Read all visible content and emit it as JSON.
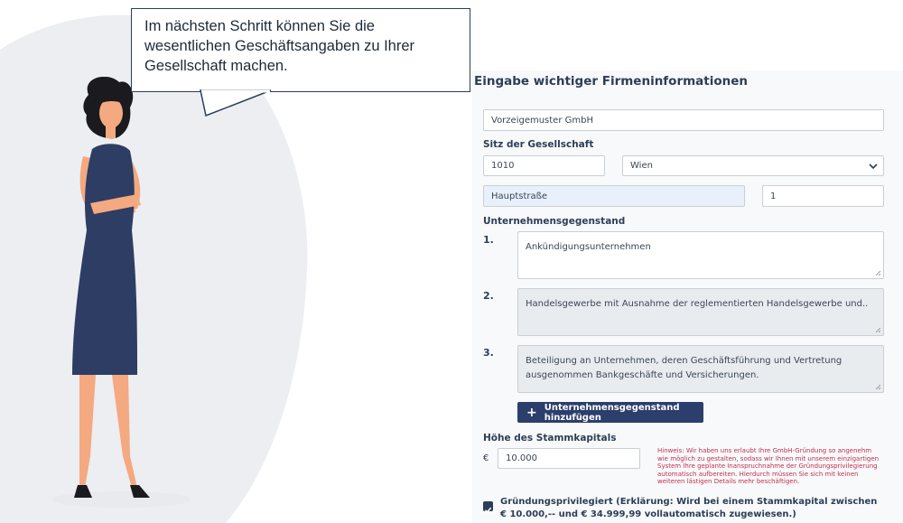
{
  "bubble": {
    "text": "Im nächsten Schritt können Sie die wesentlichen Geschäftsangaben zu Ihrer Gesellschaft machen."
  },
  "panel": {
    "title": "Eingabe wichtiger Firmeninformationen",
    "company_name": "Vorzeigemuster GmbH",
    "seat_label": "Sitz der Gesellschaft",
    "zip": "1010",
    "city": "Wien",
    "street": "Hauptstraße",
    "house_number": "1",
    "purpose_label": "Unternehmensgegenstand",
    "purposes": [
      {
        "num": "1.",
        "text": "Ankündigungsunternehmen"
      },
      {
        "num": "2.",
        "text": "Handelsgewerbe mit Ausnahme der reglementierten Handelsgewerbe und.."
      },
      {
        "num": "3.",
        "text": "Beteiligung an Unternehmen, deren Geschäftsführung und Vertretung ausgenommen Bankgeschäfte und Versicherungen."
      }
    ],
    "add_purpose_button": "Unternehmensgegenstand hinzufügen",
    "capital_label": "Höhe des Stammkapitals",
    "currency": "€",
    "capital_value": "10.000",
    "hint": "Hinweis: Wir haben uns erlaubt Ihre GmbH-Gründung so angenehm wie möglich zu gestalten, sodass wir Ihnen mit unserem einzigartigen System Ihre geplante Inanspruchnahme der Gründungsprivilegierung automatisch aufbereiten. Hierdurch müssen Sie sich mit keinen weiteren lästigen Details mehr beschäftigen.",
    "privilege_checkbox": "Gründungsprivilegiert (Erklärung: Wird bei einem Stammkapital zwischen € 10.000,-- und € 34.999,99 vollautomatisch zugewiesen.)"
  },
  "colors": {
    "navy": "#2c3e57",
    "button": "#2c3e6b",
    "hint": "#c0314f",
    "dress": "#2e3d63"
  }
}
